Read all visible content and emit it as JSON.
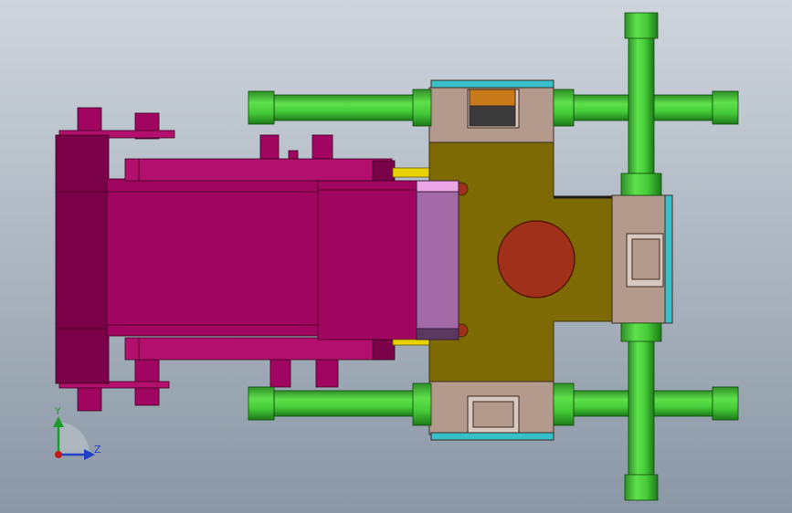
{
  "viewport": {
    "background_top": "#cfd5dd",
    "background_bottom": "#8a97a5"
  },
  "colors": {
    "housing": "#a0055f",
    "housing_dark": "#7a0047",
    "housing_light": "#b3106e",
    "body": "#7d6a05",
    "bore": "#a0301a",
    "valve_block": "#b39a8c",
    "pipe": "#45cc38",
    "pipe_dark": "#1d7a19",
    "cylinder": "#a36aa8",
    "cylinder_top": "#e9a5e6",
    "accent_cyan": "#37c0c8",
    "accent_yellow": "#e8d200",
    "accent_orange": "#c87a1a"
  },
  "triad": {
    "y_label": "Y",
    "z_label": "Z",
    "y_color": "#1c9a2b",
    "z_color": "#1f3fc8",
    "x_color": "#c81a1a"
  }
}
